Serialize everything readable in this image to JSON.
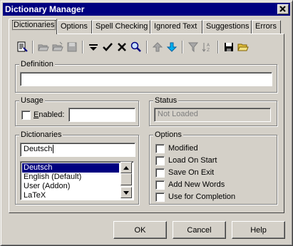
{
  "window": {
    "title": "Dictionary Manager"
  },
  "tabs": [
    {
      "label": "Dictionaries",
      "active": true
    },
    {
      "label": "Options"
    },
    {
      "label": "Spell Checking"
    },
    {
      "label": "Ignored Text"
    },
    {
      "label": "Suggestions"
    },
    {
      "label": "Errors"
    }
  ],
  "toolbar": {
    "icons": [
      "properties-icon",
      "open-folder-icon",
      "open-folder-icon",
      "save-icon",
      "filter-icon",
      "check-icon",
      "delete-icon",
      "search-icon",
      "arrow-up-icon",
      "arrow-down-icon",
      "funnel-icon",
      "sort-az-icon",
      "save-icon",
      "open-icon"
    ]
  },
  "definition": {
    "title": "Definition",
    "value": ""
  },
  "usage": {
    "title": "Usage",
    "enabled_label": "Enabled:",
    "enabled_checked": false,
    "value": ""
  },
  "status": {
    "title": "Status",
    "value": "Not Loaded"
  },
  "dictionaries": {
    "title": "Dictionaries",
    "input_value": "Deutsch",
    "items": [
      "Deutsch",
      "English (Default)",
      "User (Addon)",
      "LaTeX"
    ],
    "selected_index": 0
  },
  "options": {
    "title": "Options",
    "items": [
      {
        "label": "Modified",
        "checked": false
      },
      {
        "label": "Load On Start",
        "checked": false
      },
      {
        "label": "Save On Exit",
        "checked": false
      },
      {
        "label": "Add New Words",
        "checked": false
      },
      {
        "label": "Use for Completion",
        "checked": false
      }
    ]
  },
  "buttons": {
    "ok": "OK",
    "cancel": "Cancel",
    "help": "Help"
  }
}
